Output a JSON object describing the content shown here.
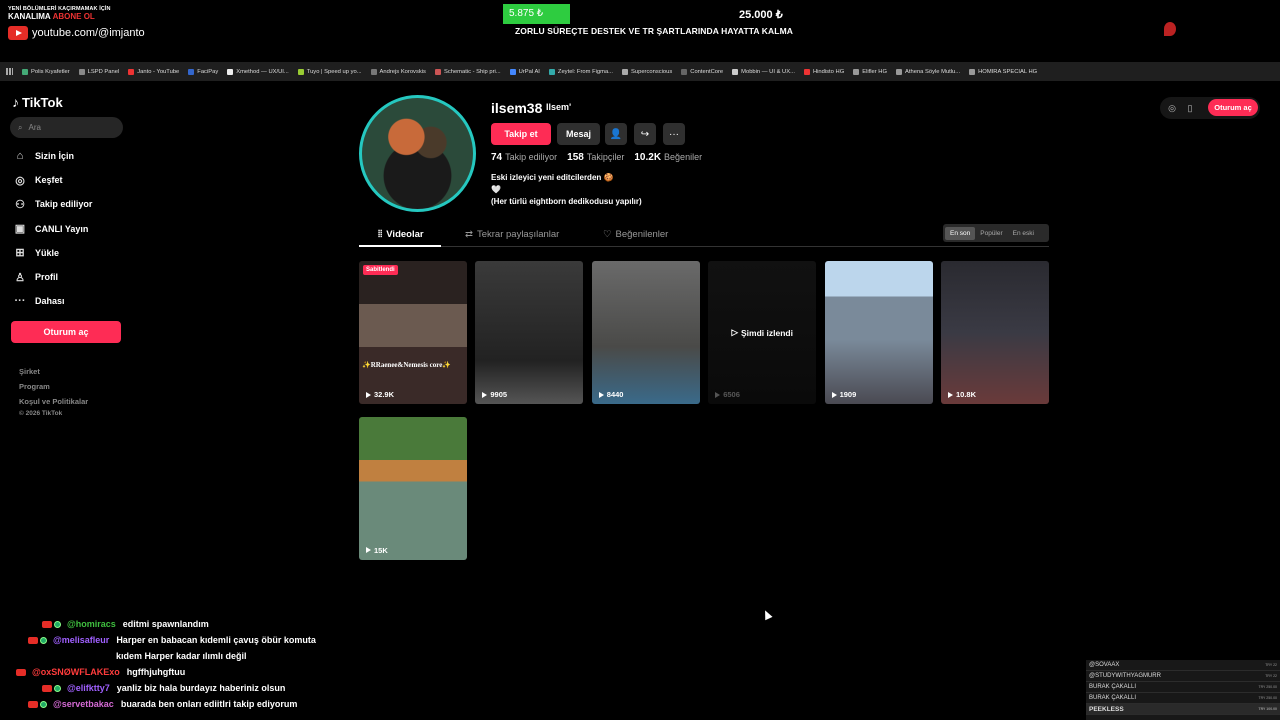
{
  "stream": {
    "promo_small": "YENİ BÖLÜMLERİ KAÇIRMAMAK İÇİN",
    "promo_big_prefix": "KANALIMA ",
    "promo_big_accent": "ABONE OL",
    "promo_channel": "youtube.com/@imjanto",
    "goal_current": "5.875 ₺",
    "goal_total": "25.000 ₺",
    "goal_progress": 0.235,
    "goal_text": "ZORLU SÜREÇTE DESTEK VE TR ŞARTLARINDA HAYATTA KALMA"
  },
  "bookmarks": [
    "Polis Kıyafetler",
    "LSPD Panel",
    "Janto - YouTube",
    "FaciPay",
    "Xmethod — UX/UI...",
    "Tuyo | Speed up yo...",
    "Andrejs Korovskis",
    "Schematic - Ship pri...",
    "UrPal AI",
    "Zeytel: From Figma...",
    "Superconscious",
    "ContentCore",
    "Mobbin — UI & UX...",
    "Hindisto HG",
    "Elifler HG",
    "Athena Söyle Mutlu...",
    "HOMIRA SPECIAL HG"
  ],
  "sidebar": {
    "logo": "TikTok",
    "search_placeholder": "Ara",
    "nav": [
      {
        "label": "Sizin İçin",
        "icon": "home-icon"
      },
      {
        "label": "Keşfet",
        "icon": "compass-icon"
      },
      {
        "label": "Takip ediliyor",
        "icon": "following-icon"
      },
      {
        "label": "CANLI Yayın",
        "icon": "live-icon"
      },
      {
        "label": "Yükle",
        "icon": "upload-icon"
      },
      {
        "label": "Profil",
        "icon": "profile-icon"
      },
      {
        "label": "Dahası",
        "icon": "more-icon"
      }
    ],
    "login": "Oturum aç",
    "footer": [
      "Şirket",
      "Program",
      "Koşul ve Politikalar"
    ],
    "copyright": "© 2026 TikTok"
  },
  "profile": {
    "username": "ilsem38",
    "nickname": "Ilsem'",
    "follow": "Takip et",
    "message": "Mesaj",
    "stats": [
      {
        "value": "74",
        "label": "Takip ediliyor"
      },
      {
        "value": "158",
        "label": "Takipçiler"
      },
      {
        "value": "10.2K",
        "label": "Beğeniler"
      }
    ],
    "bio": [
      "Eski izleyici yeni editcilerden 🍪",
      "🤍",
      "(Her türlü eightborn dedikodusu yapılır)"
    ],
    "tabs": [
      "Videolar",
      "Tekrar paylaşılanlar",
      "Beğenilenler"
    ],
    "sort": [
      "En son",
      "Popüler",
      "En eski"
    ]
  },
  "videos": [
    {
      "views": "32.9K",
      "pinned": "Sabitlendi",
      "caption": "✨RRaenee&Nemesis core✨"
    },
    {
      "views": "9905"
    },
    {
      "views": "8440"
    },
    {
      "views": "6506",
      "watched": "Şimdi izlendi"
    },
    {
      "views": "1909"
    },
    {
      "views": "10.8K"
    },
    {
      "views": "15K"
    }
  ],
  "top_right": {
    "login": "Oturum aç"
  },
  "chat": [
    {
      "user": "@homiracs",
      "color": "#3fbf3f",
      "msg": "editmi spawnlandım",
      "badges": 2
    },
    {
      "user": "@melisafleur",
      "color": "#a060ff",
      "msg": "Harper en babacan kıdemli çavuş öbür komuta",
      "msg2": "kıdem Harper kadar ılımlı değil",
      "badges": 2
    },
    {
      "user": "@oxSNØWFLAKExo",
      "color": "#ff3c3c",
      "msg": "hgffhjuhgftuu",
      "badges": 1
    },
    {
      "user": "@elifktty7",
      "color": "#a060ff",
      "msg": "yanliz biz hala burdayız haberiniz olsun",
      "badges": 2
    },
    {
      "user": "@servetbakac",
      "color": "#d46ad4",
      "msg": "buarada ben onları ediitlri takip ediyorum",
      "badges": 2
    }
  ],
  "gifts": [
    {
      "name": "@SOVAAX",
      "amt": "TRY 22"
    },
    {
      "name": "@STUDYWITHYAGMURR",
      "amt": "TRY 22"
    },
    {
      "name": "BURAK ÇAKALLI",
      "amt": "TRY 250.00"
    },
    {
      "name": "BURAK ÇAKALLI",
      "amt": "TRY 250.00"
    },
    {
      "name": "PEEKLESS",
      "amt": "TRY 100.00"
    }
  ]
}
